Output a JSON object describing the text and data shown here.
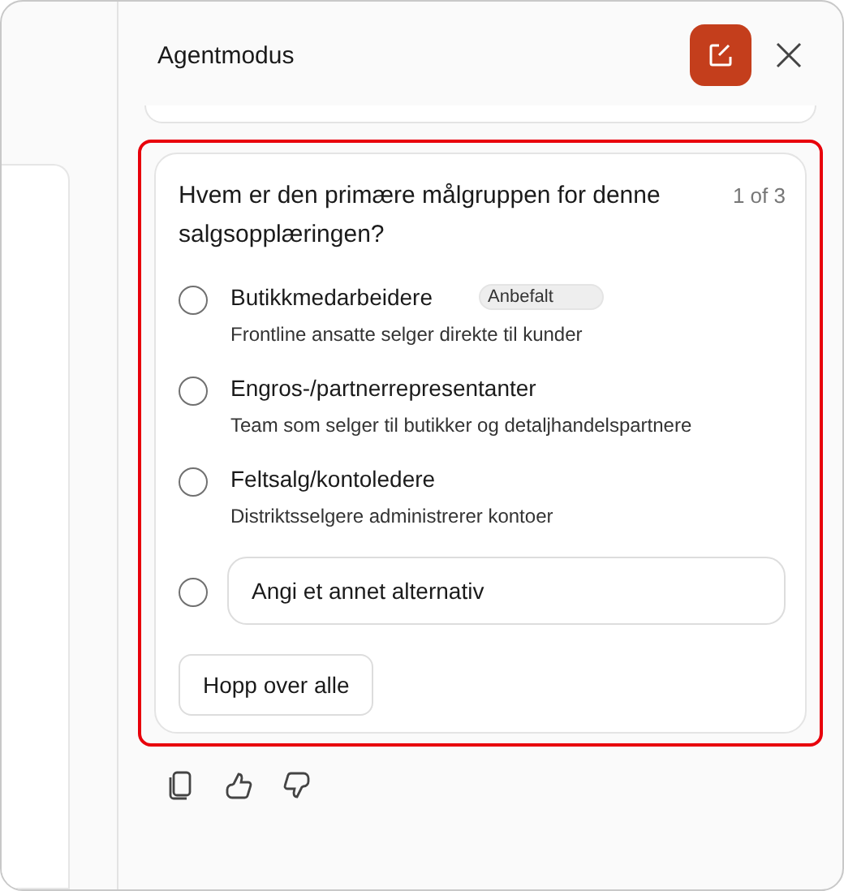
{
  "panel": {
    "title": "Agentmodus"
  },
  "question": {
    "text": "Hvem er den primære målgruppen for denne salgsopplæringen?",
    "counter": "1 of 3",
    "options": [
      {
        "label": "Butikkmedarbeidere",
        "badge": "Anbefalt",
        "description": "Frontline ansatte selger direkte til kunder",
        "selected": false
      },
      {
        "label": "Engros-/partnerrepresentanter",
        "description": "Team som selger til butikker og detaljhandelspartnere",
        "selected": false
      },
      {
        "label": "Feltsalg/kontoledere",
        "description": "Distriktsselgere administrerer kontoer",
        "selected": false
      }
    ],
    "other": {
      "placeholder": "Angi et annet alternativ",
      "selected": false
    },
    "skip_button": "Hopp over alle"
  }
}
